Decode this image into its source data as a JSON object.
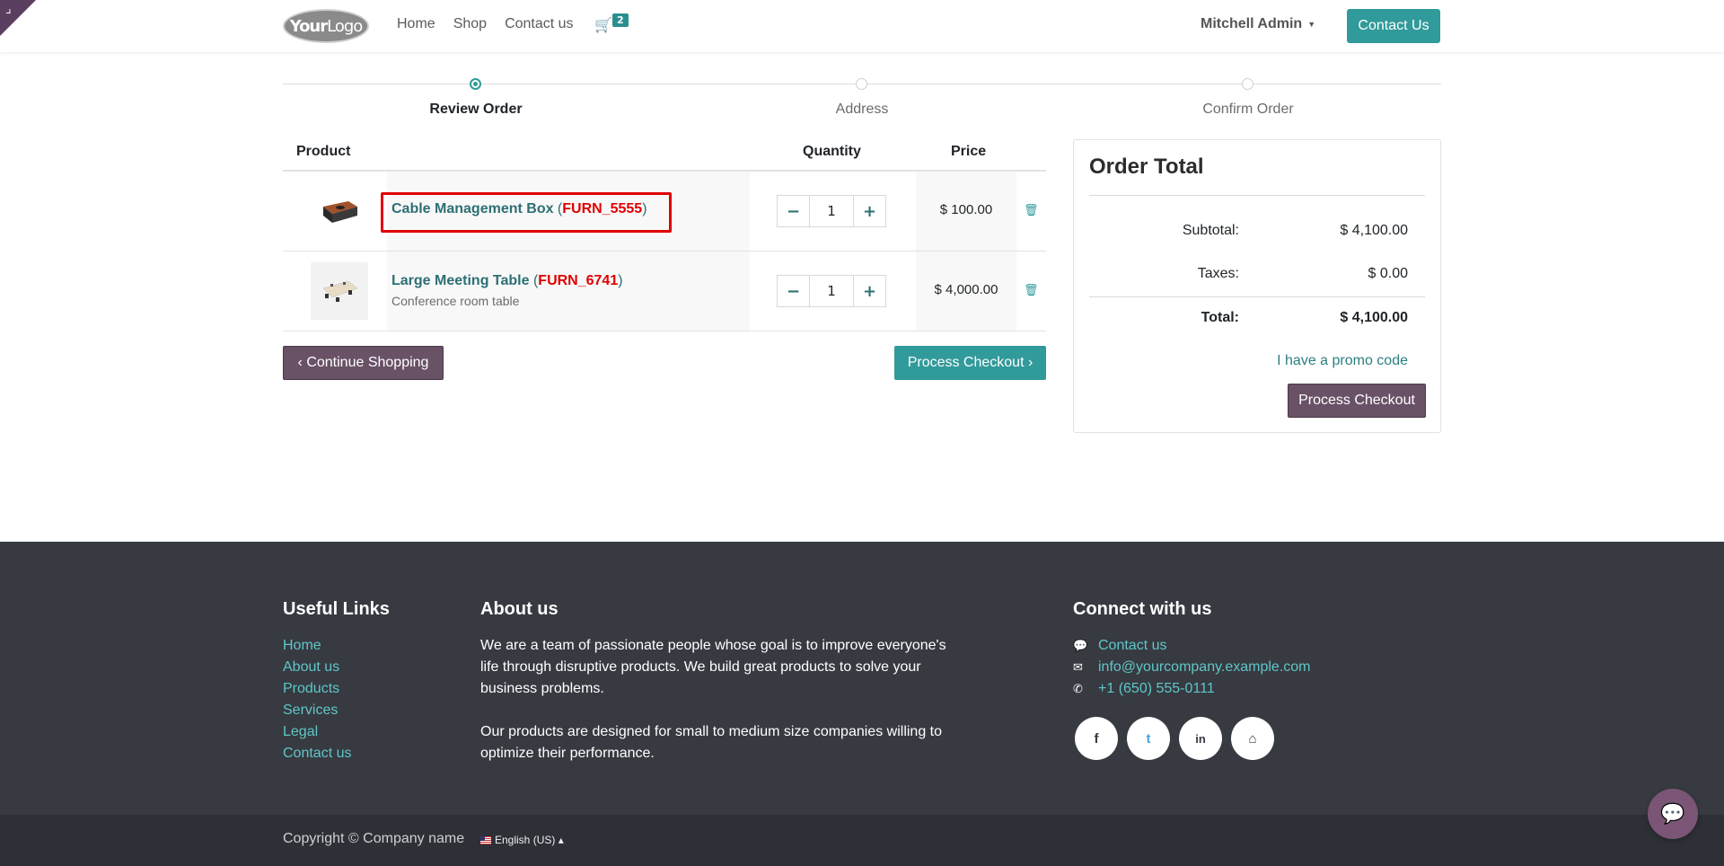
{
  "header": {
    "logo_text_bold": "Your",
    "logo_text_light": "Logo",
    "nav": [
      "Home",
      "Shop",
      "Contact us"
    ],
    "cart_count": "2",
    "user": "Mitchell Admin",
    "contact_button": "Contact Us"
  },
  "steps": [
    "Review Order",
    "Address",
    "Confirm Order"
  ],
  "table": {
    "col_product": "Product",
    "col_quantity": "Quantity",
    "col_price": "Price"
  },
  "items": [
    {
      "name": "Cable Management Box",
      "ref": "FURN_5555",
      "description": "",
      "quantity": "1",
      "price": "$ 100.00"
    },
    {
      "name": "Large Meeting Table",
      "ref": "FURN_6741",
      "description": "Conference room table",
      "quantity": "1",
      "price": "$ 4,000.00"
    }
  ],
  "actions": {
    "continue_shopping": "Continue Shopping",
    "process_checkout": "Process Checkout"
  },
  "order_total": {
    "title": "Order Total",
    "subtotal_label": "Subtotal:",
    "subtotal": "$ 4,100.00",
    "taxes_label": "Taxes:",
    "taxes": "$ 0.00",
    "total_label": "Total:",
    "total": "$ 4,100.00",
    "promo": "I have a promo code",
    "checkout": "Process Checkout"
  },
  "footer": {
    "useful_links_title": "Useful Links",
    "useful_links": [
      "Home",
      "About us",
      "Products",
      "Services",
      "Legal",
      "Contact us"
    ],
    "about_title": "About us",
    "about_p1": "We are a team of passionate people whose goal is to improve everyone's life through disruptive products. We build great products to solve your business problems.",
    "about_p2": "Our products are designed for small to medium size companies willing to optimize their performance.",
    "connect_title": "Connect with us",
    "connect_contact": "Contact us",
    "connect_email": "info@yourcompany.example.com",
    "connect_phone": "+1 (650) 555-0111",
    "socials": [
      "facebook-icon",
      "twitter-icon",
      "linkedin-icon",
      "home-icon"
    ]
  },
  "copyright": "Copyright © Company name",
  "language": "English (US)"
}
